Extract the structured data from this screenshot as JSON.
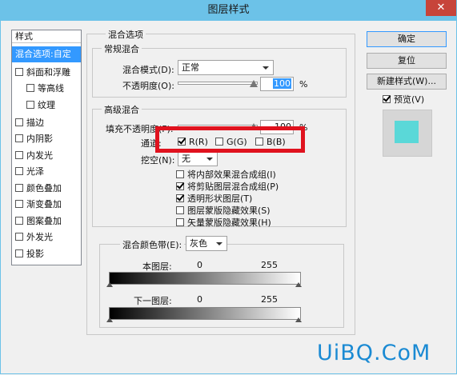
{
  "window": {
    "title": "图层样式",
    "close_icon": "close-icon"
  },
  "style_list": {
    "header": "样式",
    "items": [
      {
        "label": "混合选项:自定",
        "selected": true,
        "checkbox": false,
        "indent": false
      },
      {
        "label": "斜面和浮雕",
        "checkbox": true,
        "checked": false,
        "indent": false
      },
      {
        "label": "等高线",
        "checkbox": true,
        "checked": false,
        "indent": true
      },
      {
        "label": "纹理",
        "checkbox": true,
        "checked": false,
        "indent": true
      },
      {
        "label": "描边",
        "checkbox": true,
        "checked": false,
        "indent": false
      },
      {
        "label": "内阴影",
        "checkbox": true,
        "checked": false,
        "indent": false
      },
      {
        "label": "内发光",
        "checkbox": true,
        "checked": false,
        "indent": false
      },
      {
        "label": "光泽",
        "checkbox": true,
        "checked": false,
        "indent": false
      },
      {
        "label": "颜色叠加",
        "checkbox": true,
        "checked": false,
        "indent": false
      },
      {
        "label": "渐变叠加",
        "checkbox": true,
        "checked": false,
        "indent": false
      },
      {
        "label": "图案叠加",
        "checkbox": true,
        "checked": false,
        "indent": false
      },
      {
        "label": "外发光",
        "checkbox": true,
        "checked": false,
        "indent": false
      },
      {
        "label": "投影",
        "checkbox": true,
        "checked": false,
        "indent": false
      }
    ]
  },
  "blend_options": {
    "title": "混合选项",
    "general": {
      "title": "常规混合",
      "mode_label": "混合模式(D):",
      "mode_value": "正常",
      "opacity_label": "不透明度(O):",
      "opacity_value": "100",
      "opacity_unit": "%"
    },
    "advanced": {
      "title": "高级混合",
      "fill_label": "填充不透明度(F):",
      "fill_value": "100",
      "fill_unit": "%",
      "channels_label": "通道:",
      "channels": [
        {
          "label": "R(R)",
          "checked": true
        },
        {
          "label": "G(G)",
          "checked": false
        },
        {
          "label": "B(B)",
          "checked": false
        }
      ],
      "knockout_label": "挖空(N):",
      "knockout_value": "无",
      "options": [
        {
          "label": "将内部效果混合成组(I)",
          "checked": false
        },
        {
          "label": "将剪贴图层混合成组(P)",
          "checked": true
        },
        {
          "label": "透明形状图层(T)",
          "checked": true
        },
        {
          "label": "图层蒙版隐藏效果(S)",
          "checked": false
        },
        {
          "label": "矢量蒙版隐藏效果(H)",
          "checked": false
        }
      ]
    },
    "blend_if": {
      "label": "混合颜色带(E):",
      "value": "灰色",
      "this_layer_label": "本图层:",
      "this_layer_min": "0",
      "this_layer_max": "255",
      "underlying_label": "下一图层:",
      "underlying_min": "0",
      "underlying_max": "255"
    }
  },
  "buttons": {
    "ok": "确定",
    "reset": "复位",
    "new_style": "新建样式(W)...",
    "preview_label": "预览(V)",
    "preview_checked": true
  },
  "colors": {
    "preview_swatch": "#5ad8d8",
    "highlight": "#e0121e",
    "selection": "#3399ff"
  },
  "watermark": "UiBQ.CoM"
}
